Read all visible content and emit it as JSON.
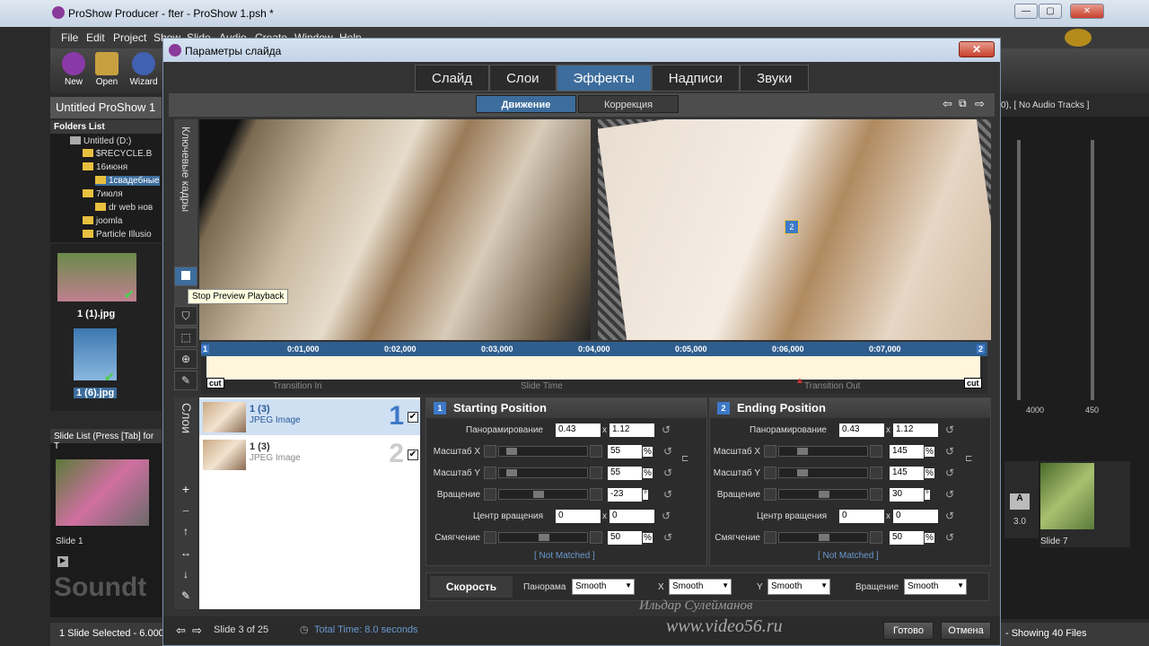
{
  "window": {
    "title": "ProShow Producer - fter - ProShow 1.psh *",
    "minimize": "—",
    "maximize": "▢",
    "close": "✕"
  },
  "menu": [
    "File",
    "Edit",
    "Project",
    "Show",
    "Slide",
    "Audio",
    "Create",
    "Window",
    "Help"
  ],
  "toolbar": {
    "new": "New",
    "open": "Open",
    "wizard": "Wizard"
  },
  "show_title": "Untitled ProShow 1",
  "audio_status": "0), [ No Audio Tracks ]",
  "folders": {
    "header": "Folders List",
    "items": [
      "Untitled (D:)",
      "$RECYCLE.B",
      "16июня",
      "1свадебные",
      "7июля",
      "dr web нов",
      "joomla",
      "Particle Illusio"
    ]
  },
  "thumb_labels": [
    "1 (1).jpg",
    "1 (6).jpg"
  ],
  "slide_list": {
    "header": "Slide List (Press [Tab] for T",
    "slide1": "Slide 1",
    "slide7": "Slide 7",
    "trans": "3.0",
    "ruler1": "4000",
    "ruler2": "450"
  },
  "statusbar": {
    "left": "1 Slide Selected - 6.000 s",
    "right": "- Showing 40 Files"
  },
  "watermark": {
    "name": "Ильдар Сулейманов",
    "site": "www.video56.ru",
    "sound": "Soundt"
  },
  "dialog": {
    "title": "Параметры слайда",
    "close": "✕",
    "tabs": [
      "Слайд",
      "Слои",
      "Эффекты",
      "Надписи",
      "Звуки"
    ],
    "subtabs": [
      "Движение",
      "Коррекция"
    ],
    "keyframes_label": "Ключевые кадры",
    "tooltip": "Stop Preview Playback",
    "timeline": {
      "start_marker": "1",
      "end_marker": "2",
      "ticks": [
        "0:01,000",
        "0:02,000",
        "0:03,000",
        "0:04,000",
        "0:05,000",
        "0:06,000",
        "0:07,000"
      ],
      "transition_in": "Transition In",
      "slide_time": "Slide Time",
      "transition_out": "Transition Out",
      "cut": "cut"
    },
    "layers_label": "Слои",
    "layers": [
      {
        "name": "1 (3)",
        "kind": "JPEG Image",
        "num": "1"
      },
      {
        "name": "1 (3)",
        "kind": "JPEG Image",
        "num": "2"
      }
    ],
    "starting": {
      "title": "Starting Position",
      "badge": "1",
      "pan_label": "Панорамирование",
      "pan_x": "0.43",
      "pan_y": "1.12",
      "scale_x_label": "Масштаб X",
      "scale_x": "55",
      "scale_y_label": "Масштаб Y",
      "scale_y": "55",
      "rotate_label": "Вращение",
      "rotate": "-23",
      "center_label": "Центр вращения",
      "center_x": "0",
      "center_y": "0",
      "smooth_label": "Смягчение",
      "smooth": "50",
      "not_matched": "[ Not Matched ]"
    },
    "ending": {
      "title": "Ending Position",
      "badge": "2",
      "pan_label": "Панорамирование",
      "pan_x": "0.43",
      "pan_y": "1.12",
      "scale_x_label": "Масштаб X",
      "scale_x": "145",
      "scale_y_label": "Масштаб Y",
      "scale_y": "145",
      "rotate_label": "Вращение",
      "rotate": "30",
      "center_label": "Центр вращения",
      "center_x": "0",
      "center_y": "0",
      "smooth_label": "Смягчение",
      "smooth": "50",
      "not_matched": "[ Not Matched ]"
    },
    "units": {
      "x": "x",
      "percent": "%",
      "degree": "°"
    },
    "speed": {
      "button": "Скорость",
      "pan_label": "Панорама",
      "pan": "Smooth",
      "x_label": "X",
      "x": "Smooth",
      "y_label": "Y",
      "y": "Smooth",
      "rot_label": "Вращение",
      "rot": "Smooth"
    },
    "footer": {
      "slide_info": "Slide 3 of 25",
      "total_time": "Total Time: 8.0 seconds",
      "ok": "Готово",
      "cancel": "Отмена"
    }
  }
}
